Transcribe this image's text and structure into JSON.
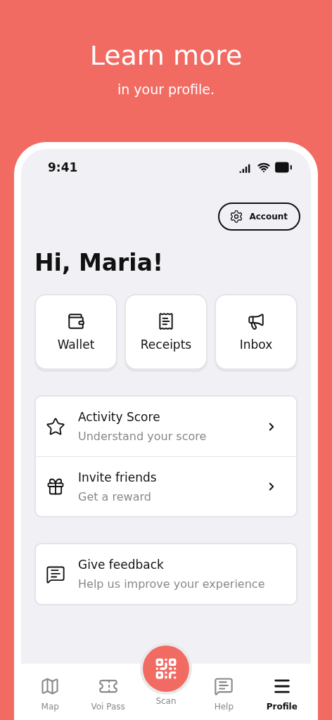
{
  "headline": "Learn more",
  "subheadline": "in your profile.",
  "status_bar": {
    "time": "9:41"
  },
  "account_button": {
    "label": "Account"
  },
  "greeting": "Hi, Maria!",
  "tiles": [
    {
      "label": "Wallet"
    },
    {
      "label": "Receipts"
    },
    {
      "label": "Inbox"
    }
  ],
  "list_groups": [
    [
      {
        "title": "Activity Score",
        "subtitle": "Understand your score",
        "chevron": true
      },
      {
        "title": "Invite friends",
        "subtitle": "Get a reward",
        "chevron": true
      }
    ],
    [
      {
        "title": "Give feedback",
        "subtitle": "Help us improve your experience",
        "chevron": false
      }
    ]
  ],
  "tab_bar": [
    {
      "label": "Map",
      "selected": false,
      "kind": "tab"
    },
    {
      "label": "Voi Pass",
      "selected": false,
      "kind": "tab"
    },
    {
      "label": "Scan",
      "selected": false,
      "kind": "fab"
    },
    {
      "label": "Help",
      "selected": false,
      "kind": "tab"
    },
    {
      "label": "Profile",
      "selected": true,
      "kind": "tab"
    }
  ]
}
